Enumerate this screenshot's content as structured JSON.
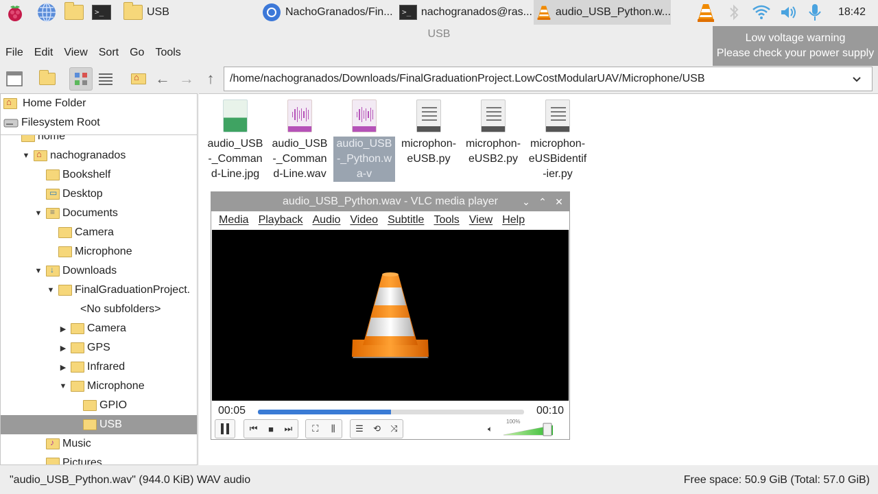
{
  "taskbar": {
    "launchers": [
      {
        "name": "raspberry-menu-icon"
      },
      {
        "name": "web-browser-icon"
      },
      {
        "name": "file-manager-icon"
      },
      {
        "name": "terminal-icon"
      }
    ],
    "tasks": [
      {
        "label": "USB",
        "icon": "folder-icon",
        "active": false
      },
      {
        "label": "NachoGranados/Fin...",
        "icon": "chromium-icon",
        "active": false
      },
      {
        "label": "nachogranados@ras...",
        "icon": "terminal-icon",
        "active": false
      },
      {
        "label": "audio_USB_Python.w...",
        "icon": "vlc-icon",
        "active": true
      }
    ],
    "clock": "18:42"
  },
  "window": {
    "title": "USB"
  },
  "tooltip": {
    "line1": "Low voltage warning",
    "line2": "Please check your power supply"
  },
  "menubar": {
    "items": [
      "File",
      "Edit",
      "View",
      "Sort",
      "Go",
      "Tools"
    ]
  },
  "toolbar": {
    "path": "/home/nachogranados/Downloads/FinalGraduationProject.LowCostModularUAV/Microphone/USB"
  },
  "sidebar": {
    "places": [
      {
        "label": "Home Folder",
        "icon": "home-folder-icon"
      },
      {
        "label": "Filesystem Root",
        "icon": "drive-icon"
      }
    ],
    "tree": [
      {
        "label": "home",
        "depth": 1,
        "expander": "",
        "kind": "folder"
      },
      {
        "label": "nachogranados",
        "depth": 2,
        "expander": "▼",
        "kind": "home"
      },
      {
        "label": "Bookshelf",
        "depth": 3,
        "expander": "",
        "kind": "folder"
      },
      {
        "label": "Desktop",
        "depth": 3,
        "expander": "",
        "kind": "desk"
      },
      {
        "label": "Documents",
        "depth": 3,
        "expander": "▼",
        "kind": "doc"
      },
      {
        "label": "Camera",
        "depth": 4,
        "expander": "",
        "kind": "folder"
      },
      {
        "label": "Microphone",
        "depth": 4,
        "expander": "",
        "kind": "folder"
      },
      {
        "label": "Downloads",
        "depth": 3,
        "expander": "▼",
        "kind": "dl"
      },
      {
        "label": "FinalGraduationProject.",
        "depth": 4,
        "expander": "▼",
        "kind": "folder"
      },
      {
        "label": "<No subfolders>",
        "depth": 6,
        "expander": "",
        "kind": "none"
      },
      {
        "label": "Camera",
        "depth": 5,
        "expander": "▶",
        "kind": "folder"
      },
      {
        "label": "GPS",
        "depth": 5,
        "expander": "▶",
        "kind": "folder"
      },
      {
        "label": "Infrared",
        "depth": 5,
        "expander": "▶",
        "kind": "folder"
      },
      {
        "label": "Microphone",
        "depth": 5,
        "expander": "▼",
        "kind": "folder"
      },
      {
        "label": "GPIO",
        "depth": 6,
        "expander": "",
        "kind": "folder"
      },
      {
        "label": "USB",
        "depth": 6,
        "expander": "",
        "kind": "folder",
        "selected": true
      },
      {
        "label": "Music",
        "depth": 3,
        "expander": "",
        "kind": "mus"
      },
      {
        "label": "Pictures",
        "depth": 3,
        "expander": "",
        "kind": "folder"
      }
    ]
  },
  "files": [
    {
      "name": "audio_USB-_Command-Line.jpg",
      "type": "image",
      "selected": false
    },
    {
      "name": "audio_USB-_Command-Line.wav",
      "type": "audio",
      "selected": false
    },
    {
      "name": "audio_USB-_Python.wa-v",
      "type": "audio",
      "selected": true
    },
    {
      "name": "microphon-eUSB.py",
      "type": "text",
      "selected": false
    },
    {
      "name": "microphon-eUSB2.py",
      "type": "text",
      "selected": false
    },
    {
      "name": "microphon-eUSBidentif-ier.py",
      "type": "text",
      "selected": false
    }
  ],
  "vlc": {
    "title": "audio_USB_Python.wav - VLC media player",
    "menu": [
      "Media",
      "Playback",
      "Audio",
      "Video",
      "Subtitle",
      "Tools",
      "View",
      "Help"
    ],
    "time_current": "00:05",
    "time_total": "00:10",
    "progress_fraction": 0.5,
    "volume_label": "100%",
    "volume_fraction": 1.0
  },
  "status": {
    "selection": "\"audio_USB_Python.wav\" (944.0 KiB) WAV audio",
    "free_space": "Free space: 50.9 GiB (Total: 57.0 GiB)"
  }
}
